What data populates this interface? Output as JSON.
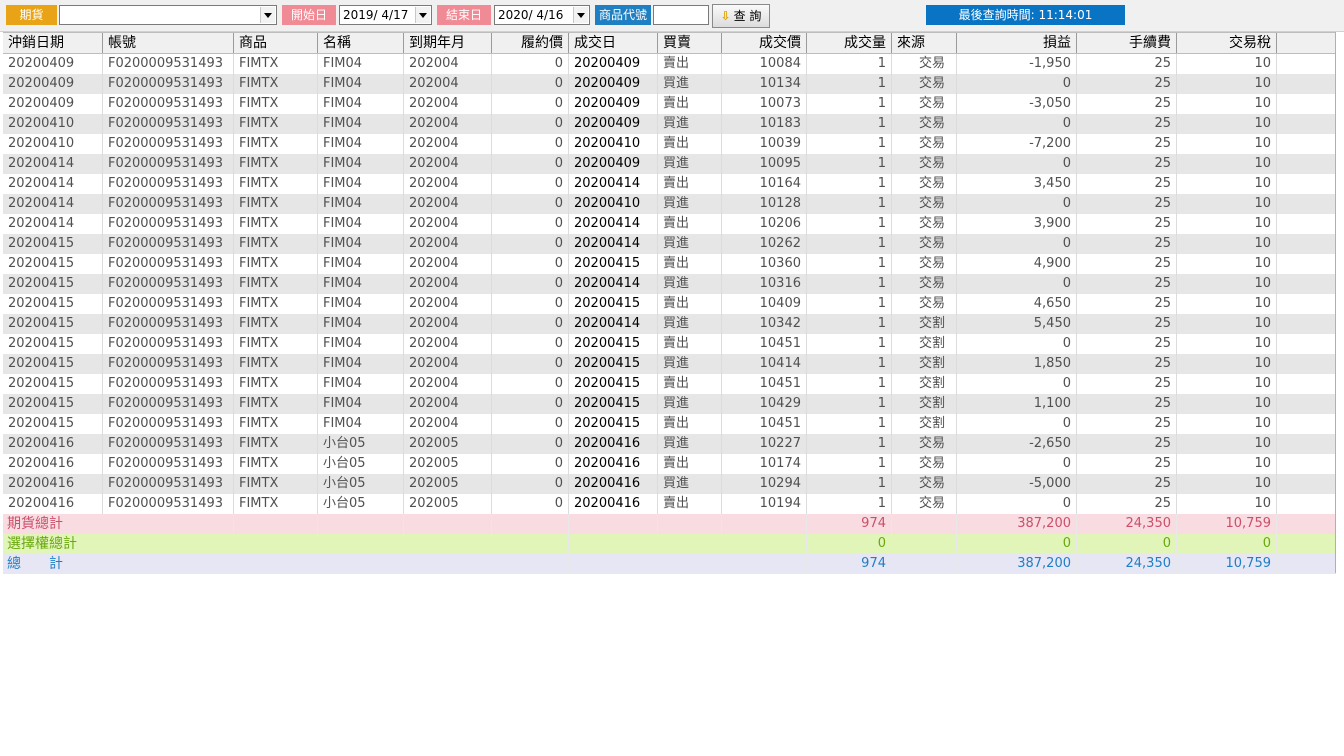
{
  "toolbar": {
    "type_label": "期貨",
    "account_value": "",
    "start_label": "開始日",
    "start_value": "2019/ 4/17",
    "end_label": "結束日",
    "end_value": "2020/ 4/16",
    "product_code_label": "商品代號",
    "product_code_value": "",
    "query_label": "查 詢",
    "last_query": "最後查詢時間: 11:14:01"
  },
  "columns": [
    "沖銷日期",
    "帳號",
    "商品",
    "名稱",
    "到期年月",
    "履約價",
    "成交日",
    "買賣",
    "成交價",
    "成交量",
    "來源",
    "損益",
    "手續費",
    "交易稅"
  ],
  "rows": [
    [
      "20200409",
      "F0200009531493",
      "FIMTX",
      "FIM04",
      "202004",
      "0",
      "20200409",
      "賣出",
      "10084",
      "1",
      "交易",
      "-1,950",
      "25",
      "10"
    ],
    [
      "20200409",
      "F0200009531493",
      "FIMTX",
      "FIM04",
      "202004",
      "0",
      "20200409",
      "買進",
      "10134",
      "1",
      "交易",
      "0",
      "25",
      "10"
    ],
    [
      "20200409",
      "F0200009531493",
      "FIMTX",
      "FIM04",
      "202004",
      "0",
      "20200409",
      "賣出",
      "10073",
      "1",
      "交易",
      "-3,050",
      "25",
      "10"
    ],
    [
      "20200410",
      "F0200009531493",
      "FIMTX",
      "FIM04",
      "202004",
      "0",
      "20200409",
      "買進",
      "10183",
      "1",
      "交易",
      "0",
      "25",
      "10"
    ],
    [
      "20200410",
      "F0200009531493",
      "FIMTX",
      "FIM04",
      "202004",
      "0",
      "20200410",
      "賣出",
      "10039",
      "1",
      "交易",
      "-7,200",
      "25",
      "10"
    ],
    [
      "20200414",
      "F0200009531493",
      "FIMTX",
      "FIM04",
      "202004",
      "0",
      "20200409",
      "買進",
      "10095",
      "1",
      "交易",
      "0",
      "25",
      "10"
    ],
    [
      "20200414",
      "F0200009531493",
      "FIMTX",
      "FIM04",
      "202004",
      "0",
      "20200414",
      "賣出",
      "10164",
      "1",
      "交易",
      "3,450",
      "25",
      "10"
    ],
    [
      "20200414",
      "F0200009531493",
      "FIMTX",
      "FIM04",
      "202004",
      "0",
      "20200410",
      "買進",
      "10128",
      "1",
      "交易",
      "0",
      "25",
      "10"
    ],
    [
      "20200414",
      "F0200009531493",
      "FIMTX",
      "FIM04",
      "202004",
      "0",
      "20200414",
      "賣出",
      "10206",
      "1",
      "交易",
      "3,900",
      "25",
      "10"
    ],
    [
      "20200415",
      "F0200009531493",
      "FIMTX",
      "FIM04",
      "202004",
      "0",
      "20200414",
      "買進",
      "10262",
      "1",
      "交易",
      "0",
      "25",
      "10"
    ],
    [
      "20200415",
      "F0200009531493",
      "FIMTX",
      "FIM04",
      "202004",
      "0",
      "20200415",
      "賣出",
      "10360",
      "1",
      "交易",
      "4,900",
      "25",
      "10"
    ],
    [
      "20200415",
      "F0200009531493",
      "FIMTX",
      "FIM04",
      "202004",
      "0",
      "20200414",
      "買進",
      "10316",
      "1",
      "交易",
      "0",
      "25",
      "10"
    ],
    [
      "20200415",
      "F0200009531493",
      "FIMTX",
      "FIM04",
      "202004",
      "0",
      "20200415",
      "賣出",
      "10409",
      "1",
      "交易",
      "4,650",
      "25",
      "10"
    ],
    [
      "20200415",
      "F0200009531493",
      "FIMTX",
      "FIM04",
      "202004",
      "0",
      "20200414",
      "買進",
      "10342",
      "1",
      "交割",
      "5,450",
      "25",
      "10"
    ],
    [
      "20200415",
      "F0200009531493",
      "FIMTX",
      "FIM04",
      "202004",
      "0",
      "20200415",
      "賣出",
      "10451",
      "1",
      "交割",
      "0",
      "25",
      "10"
    ],
    [
      "20200415",
      "F0200009531493",
      "FIMTX",
      "FIM04",
      "202004",
      "0",
      "20200415",
      "買進",
      "10414",
      "1",
      "交割",
      "1,850",
      "25",
      "10"
    ],
    [
      "20200415",
      "F0200009531493",
      "FIMTX",
      "FIM04",
      "202004",
      "0",
      "20200415",
      "賣出",
      "10451",
      "1",
      "交割",
      "0",
      "25",
      "10"
    ],
    [
      "20200415",
      "F0200009531493",
      "FIMTX",
      "FIM04",
      "202004",
      "0",
      "20200415",
      "買進",
      "10429",
      "1",
      "交割",
      "1,100",
      "25",
      "10"
    ],
    [
      "20200415",
      "F0200009531493",
      "FIMTX",
      "FIM04",
      "202004",
      "0",
      "20200415",
      "賣出",
      "10451",
      "1",
      "交割",
      "0",
      "25",
      "10"
    ],
    [
      "20200416",
      "F0200009531493",
      "FIMTX",
      "小台05",
      "202005",
      "0",
      "20200416",
      "買進",
      "10227",
      "1",
      "交易",
      "-2,650",
      "25",
      "10"
    ],
    [
      "20200416",
      "F0200009531493",
      "FIMTX",
      "小台05",
      "202005",
      "0",
      "20200416",
      "賣出",
      "10174",
      "1",
      "交易",
      "0",
      "25",
      "10"
    ],
    [
      "20200416",
      "F0200009531493",
      "FIMTX",
      "小台05",
      "202005",
      "0",
      "20200416",
      "買進",
      "10294",
      "1",
      "交易",
      "-5,000",
      "25",
      "10"
    ],
    [
      "20200416",
      "F0200009531493",
      "FIMTX",
      "小台05",
      "202005",
      "0",
      "20200416",
      "賣出",
      "10194",
      "1",
      "交易",
      "0",
      "25",
      "10"
    ]
  ],
  "totals": [
    {
      "label": "期貨總計",
      "qty": "974",
      "pnl": "387,200",
      "fee": "24,350",
      "tax": "10,759"
    },
    {
      "label": "選擇權總計",
      "qty": "0",
      "pnl": "0",
      "fee": "0",
      "tax": "0"
    },
    {
      "label": "總　　計",
      "qty": "974",
      "pnl": "387,200",
      "fee": "24,350",
      "tax": "10,759"
    }
  ],
  "colors": {
    "tag_orange": "#e8a317",
    "tag_pink": "#f08a94",
    "tag_blue": "#1f7fc3",
    "last_query_bg": "#0a74c4"
  },
  "icons": {
    "query": "down-arrow-icon"
  }
}
